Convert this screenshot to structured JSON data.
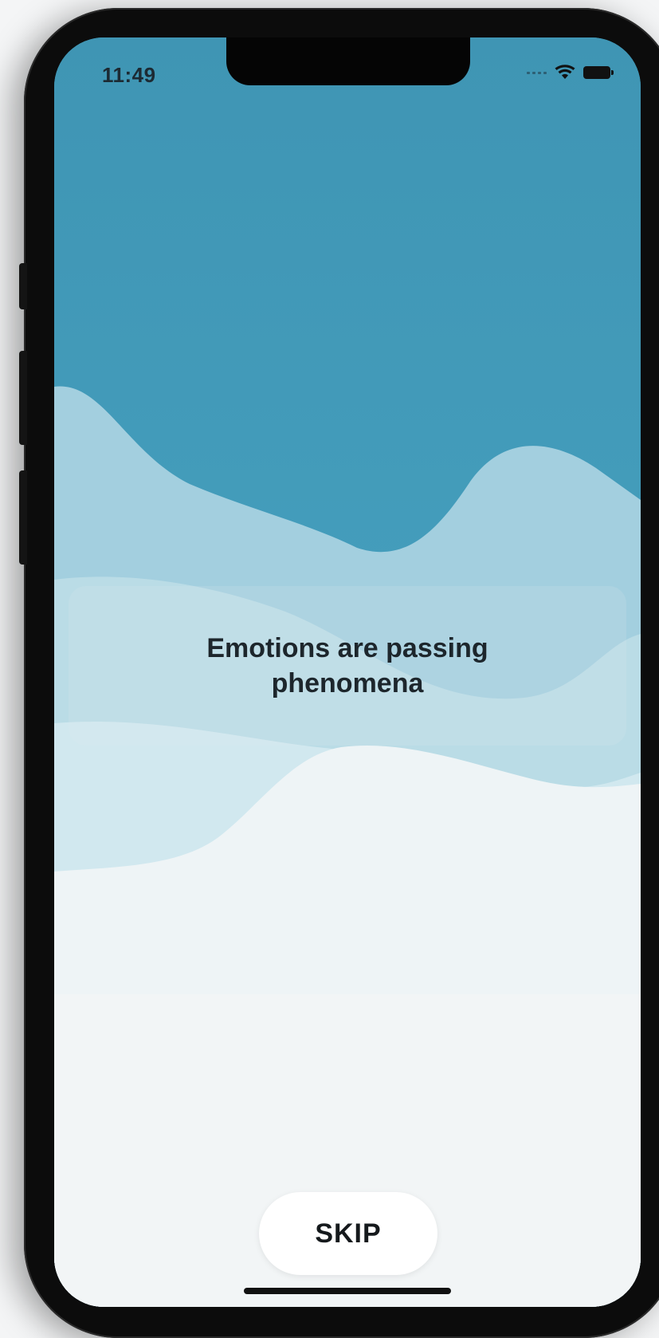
{
  "status_bar": {
    "time": "11:49",
    "icons": [
      "cellular-signal-icon",
      "wifi-icon",
      "battery-icon"
    ]
  },
  "onboarding": {
    "quote": "Emotions are passing phenomena",
    "skip_label": "SKIP"
  },
  "colors": {
    "sky_top": "#4298b7",
    "wave_light": "#a7d3e2",
    "wave_mid": "#d3e8ef",
    "background_bottom": "#f2f5f6",
    "text_dark": "#1d262c",
    "skip_bg": "#ffffff"
  }
}
